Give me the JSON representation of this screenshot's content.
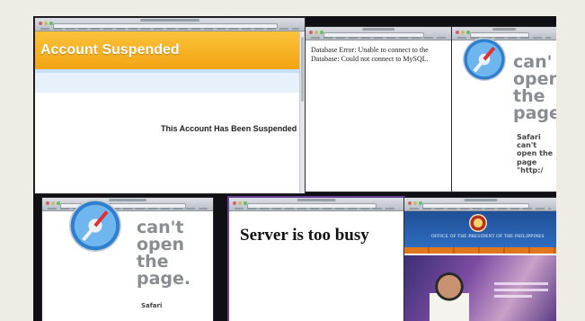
{
  "win_account": {
    "banner": "Account Suspended",
    "message": "This Account Has Been Suspended"
  },
  "win_db": {
    "line1": "Database Error: Unable to connect to the",
    "line2": "Database: Could not connect to MySQL."
  },
  "win_safari_right": {
    "big1": "can'",
    "big2": "open",
    "big3": "the",
    "big4": "page",
    "small1": "Safari",
    "small2": "can't",
    "small3": "open the",
    "small4": "page",
    "small5": "\"http:/"
  },
  "win_safari_left": {
    "big1": "can't",
    "big2": "open",
    "big3": "the",
    "big4": "page.",
    "small1": "Safari"
  },
  "win_busy": {
    "message": "Server is too busy"
  },
  "win_ph": {
    "office": "OFFICE OF THE PRESIDENT OF THE PHILIPPINES"
  },
  "colors": {
    "banner": "#f5a91b",
    "bezel": "#101014",
    "safari_gray": "#8a8d91"
  },
  "icons": [
    "safari-compass-icon",
    "safari-compass-icon",
    "presidential-seal-icon"
  ]
}
